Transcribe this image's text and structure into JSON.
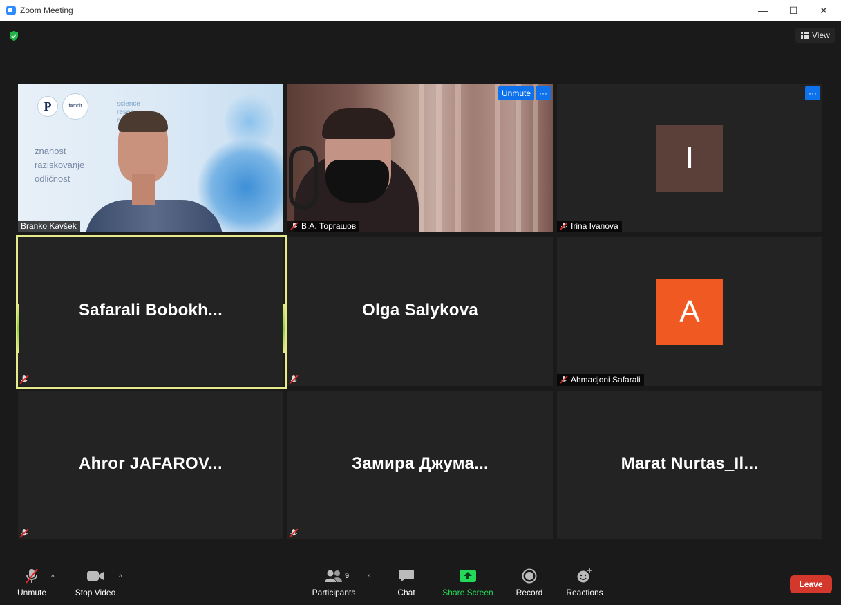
{
  "window": {
    "title": "Zoom Meeting",
    "minimize": "—",
    "maximize": "☐",
    "close": "✕"
  },
  "header": {
    "view_label": "View"
  },
  "tiles": [
    {
      "name": "Branko Kavšek",
      "type": "video",
      "muted": false
    },
    {
      "name": "В.А. Торгашов",
      "type": "video",
      "muted": true,
      "unmute_label": "Unmute",
      "more_label": "···"
    },
    {
      "name": "Irina Ivanova",
      "type": "avatar",
      "initial": "I",
      "muted": true,
      "more_label": "···"
    },
    {
      "name": "Safarali  Bobokh...",
      "type": "name",
      "muted": true,
      "active": true
    },
    {
      "name": "Olga Salykova",
      "type": "name",
      "muted": true
    },
    {
      "name": "Ahmadjoni Safarali",
      "type": "avatar",
      "initial": "A",
      "muted": true
    },
    {
      "name": "Ahror  JAFAROV...",
      "type": "name",
      "muted": true
    },
    {
      "name": "Замира  Джума...",
      "type": "name",
      "muted": true
    },
    {
      "name": "Marat  Nurtas_Il...",
      "type": "name",
      "muted": false
    }
  ],
  "slide_text": {
    "logo_letter": "P",
    "logo2": "famnit",
    "lines": [
      "znanost",
      "raziskovanje",
      "odličnost"
    ],
    "lines_en": [
      "science",
      "resea",
      "e"
    ]
  },
  "toolbar": {
    "unmute": "Unmute",
    "stop_video": "Stop Video",
    "participants": "Participants",
    "participants_count": "9",
    "chat": "Chat",
    "share_screen": "Share Screen",
    "record": "Record",
    "reactions": "Reactions",
    "leave": "Leave"
  },
  "colors": {
    "accent_blue": "#0e72ed",
    "share_green": "#23d959",
    "leave_red": "#d4382c",
    "active_border": "#e6ea8a"
  }
}
